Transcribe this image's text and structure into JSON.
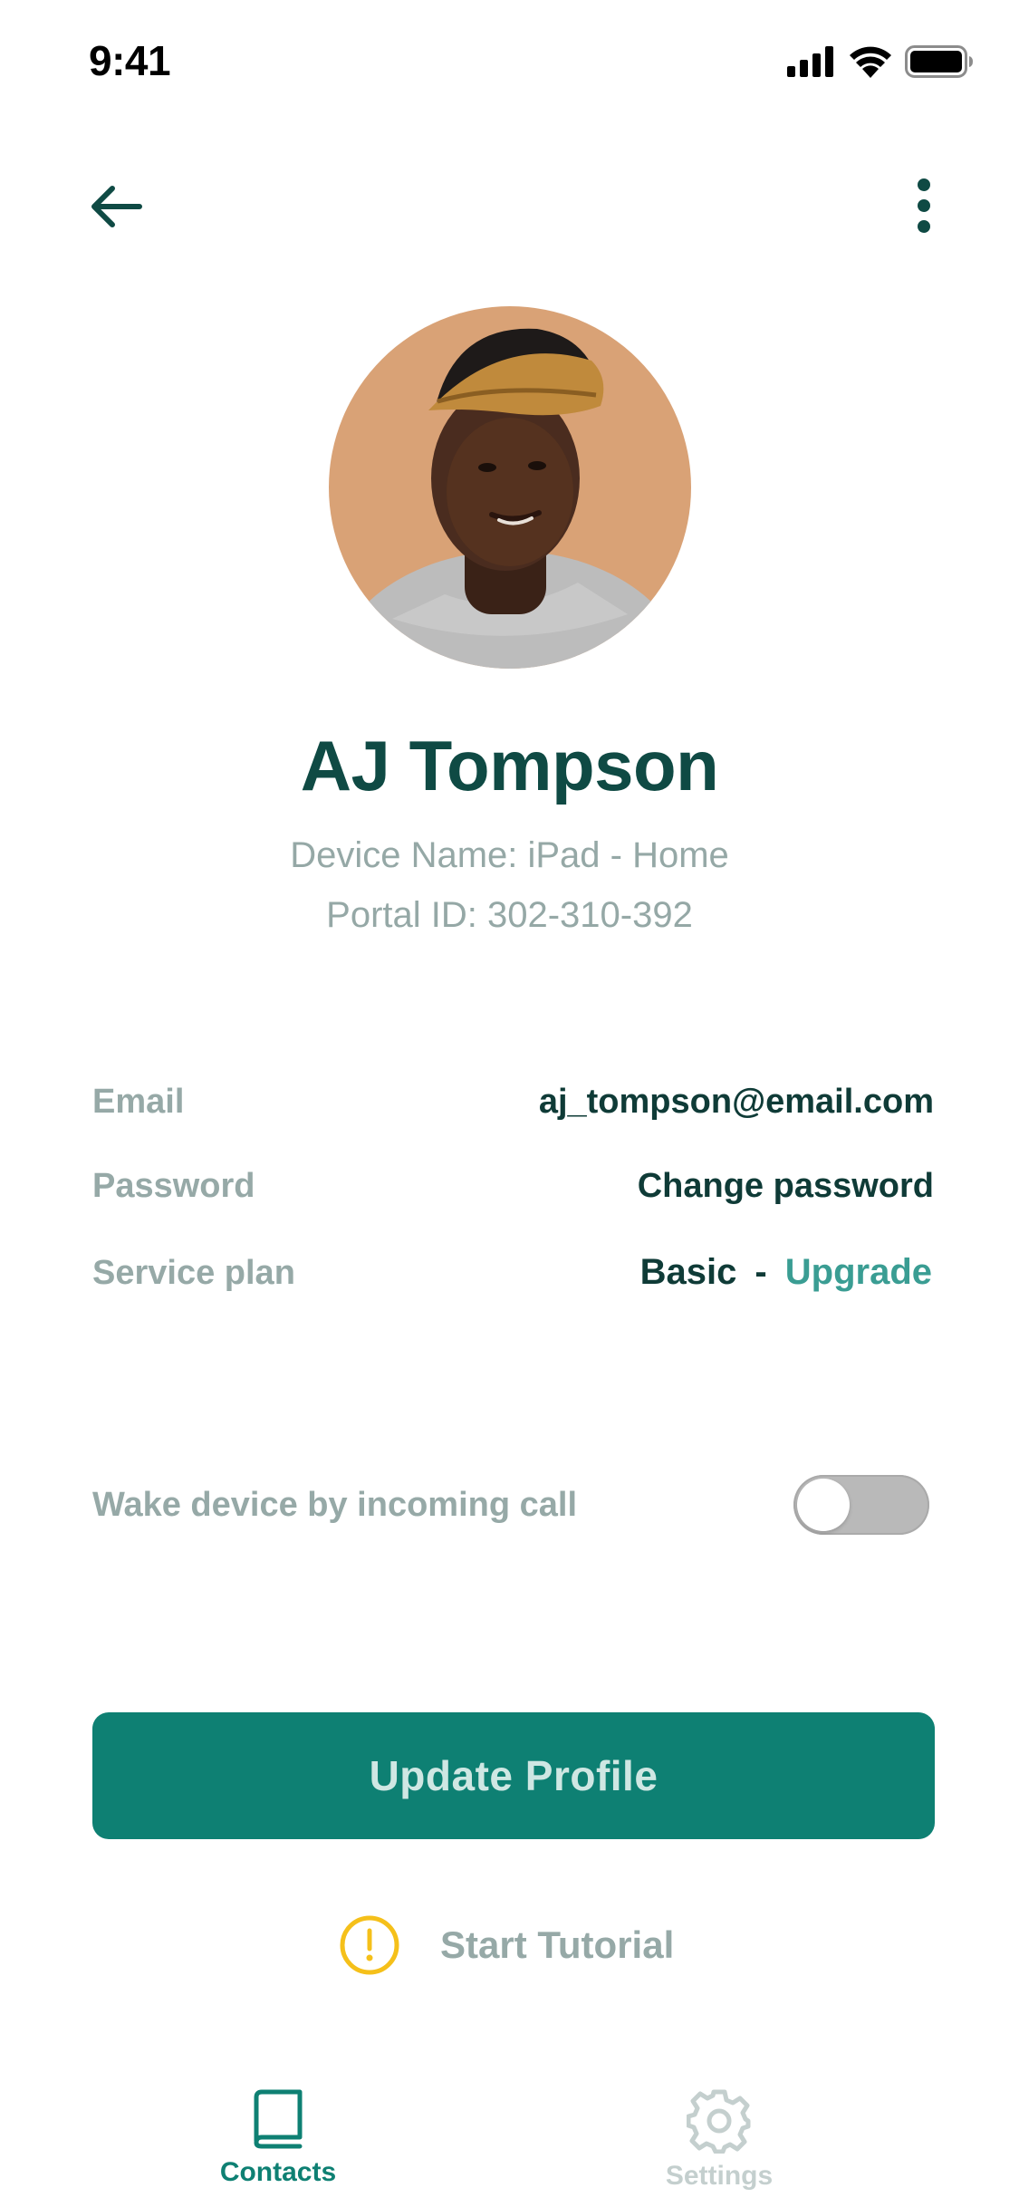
{
  "status_bar": {
    "time": "9:41",
    "icons": [
      "cellular-signal-icon",
      "wifi-icon",
      "battery-icon"
    ]
  },
  "nav": {
    "back_icon": "arrow-left-icon",
    "more_icon": "more-vertical-icon"
  },
  "profile": {
    "name": "AJ Tompson",
    "device_line": "Device Name: iPad - Home",
    "portal_line": "Portal ID: 302-310-392"
  },
  "info": {
    "email_label": "Email",
    "email_value": "aj_tompson@email.com",
    "password_label": "Password",
    "password_action": "Change password",
    "plan_label": "Service plan",
    "plan_value": "Basic",
    "plan_separator": "-",
    "plan_upgrade": "Upgrade"
  },
  "settings": {
    "wake_label": "Wake device by incoming call",
    "wake_enabled": false
  },
  "actions": {
    "update_label": "Update Profile",
    "tutorial_label": "Start Tutorial",
    "tutorial_icon": "alert-circle-icon"
  },
  "tabbar": {
    "items": [
      {
        "label": "Contacts",
        "icon": "book-icon",
        "active": true
      },
      {
        "label": "Settings",
        "icon": "gear-icon",
        "active": false
      }
    ]
  },
  "colors": {
    "accent": "#0e8073",
    "heading": "#0f4a44",
    "muted": "#96a9a7",
    "link": "#3a9d93",
    "warning": "#f5c01a",
    "inactive_tab": "#c4cfce"
  }
}
